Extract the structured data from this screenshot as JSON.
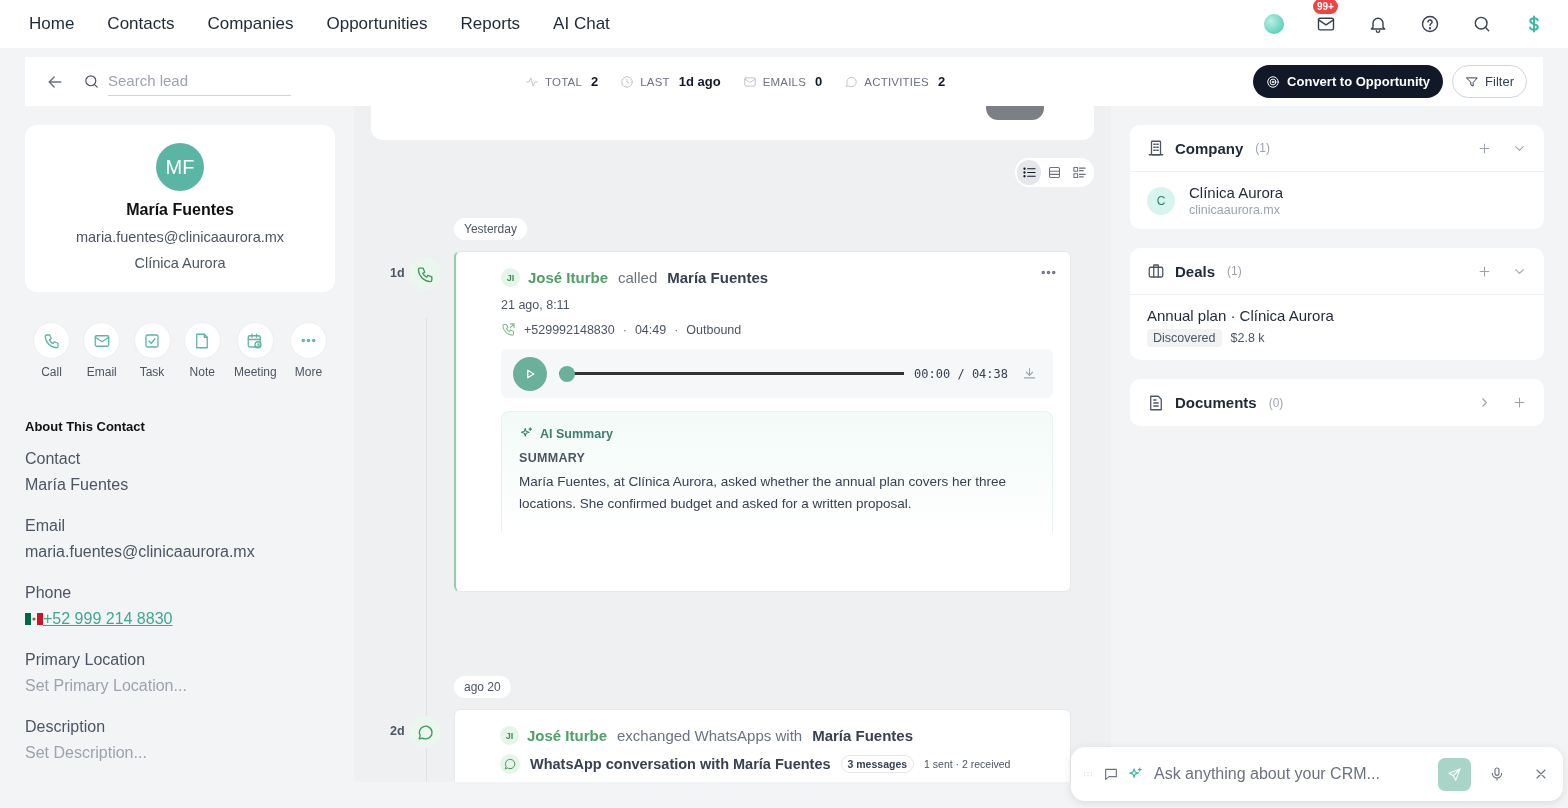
{
  "nav": {
    "items": [
      "Home",
      "Contacts",
      "Companies",
      "Opportunities",
      "Reports",
      "AI Chat"
    ],
    "badge": "99+"
  },
  "toolbar": {
    "search_placeholder": "Search lead",
    "stats": [
      {
        "kind": "total",
        "label": "TOTAL",
        "value": "2"
      },
      {
        "kind": "last",
        "label": "LAST",
        "value": "1d ago"
      },
      {
        "kind": "emails",
        "label": "EMAILS",
        "value": "0"
      },
      {
        "kind": "activities",
        "label": "ACTIVITIES",
        "value": "2"
      }
    ],
    "convert_button": "Convert to Opportunity",
    "filter_button": "Filter"
  },
  "contact": {
    "initials": "MF",
    "name": "María Fuentes",
    "email": "maria.fuentes@clinicaaurora.mx",
    "company": "Clínica Aurora"
  },
  "actions": [
    {
      "kind": "call",
      "label": "Call"
    },
    {
      "kind": "email",
      "label": "Email"
    },
    {
      "kind": "task",
      "label": "Task"
    },
    {
      "kind": "note",
      "label": "Note"
    },
    {
      "kind": "meeting",
      "label": "Meeting"
    },
    {
      "kind": "more",
      "label": "More"
    }
  ],
  "about": {
    "title": "About This Contact",
    "fields": [
      {
        "kind": "text",
        "label": "Contact",
        "value": "María Fuentes"
      },
      {
        "kind": "text",
        "label": "Email",
        "value": "maria.fuentes@clinicaaurora.mx"
      },
      {
        "kind": "phone",
        "label": "Phone",
        "value": "+52 999 214 8830"
      },
      {
        "kind": "empty",
        "label": "Primary Location",
        "placeholder": "Set Primary Location..."
      },
      {
        "kind": "empty",
        "label": "Description",
        "placeholder": "Set Description..."
      }
    ]
  },
  "view_modes": [
    {
      "kind": "list",
      "selected": true
    },
    {
      "kind": "rows",
      "selected": false
    },
    {
      "kind": "cards",
      "selected": false
    }
  ],
  "timeline": [
    {
      "kind": "call",
      "date": "Yesterday",
      "age": "1d",
      "selected": true,
      "actor_initials": "JI",
      "actor": "José Iturbe",
      "verb": "called",
      "target": "María Fuentes",
      "time": "21 ago, 8:11",
      "phone": "+529992148830",
      "duration": "04:49",
      "separator": "·",
      "direction": "Outbound",
      "player": {
        "time": "00:00 / 04:38",
        "level": 0
      },
      "summary": {
        "title": "AI Summary",
        "heading": "SUMMARY",
        "text": "María Fuentes, at Clínica Aurora, asked whether the annual plan covers her three locations. She confirmed budget and asked for a written proposal."
      }
    },
    {
      "kind": "whatsapp",
      "date": "ago 20",
      "age": "2d",
      "selected": false,
      "actor_initials": "JI",
      "actor": "José Iturbe",
      "verb": "exchanged WhatsApps with",
      "target": "María Fuentes",
      "conversation": "WhatsApp conversation with María Fuentes",
      "count": "3 messages",
      "stats": "1 sent · 2 received"
    }
  ],
  "sidebar": {
    "panels": [
      {
        "kind": "company",
        "title": "Company",
        "count": "(1)",
        "expanded": true,
        "items": [
          {
            "initial": "C",
            "name": "Clínica Aurora",
            "domain": "clinicaaurora.mx"
          }
        ]
      },
      {
        "kind": "deals",
        "title": "Deals",
        "count": "(1)",
        "expanded": true,
        "items": [
          {
            "name": "Annual plan · Clínica Aurora",
            "stage": "Discovered",
            "amount": "$2.8 k"
          }
        ]
      },
      {
        "kind": "documents",
        "title": "Documents",
        "count": "(0)",
        "expanded": false
      }
    ]
  },
  "ai_chat": {
    "placeholder": "Ask anything about your CRM..."
  }
}
